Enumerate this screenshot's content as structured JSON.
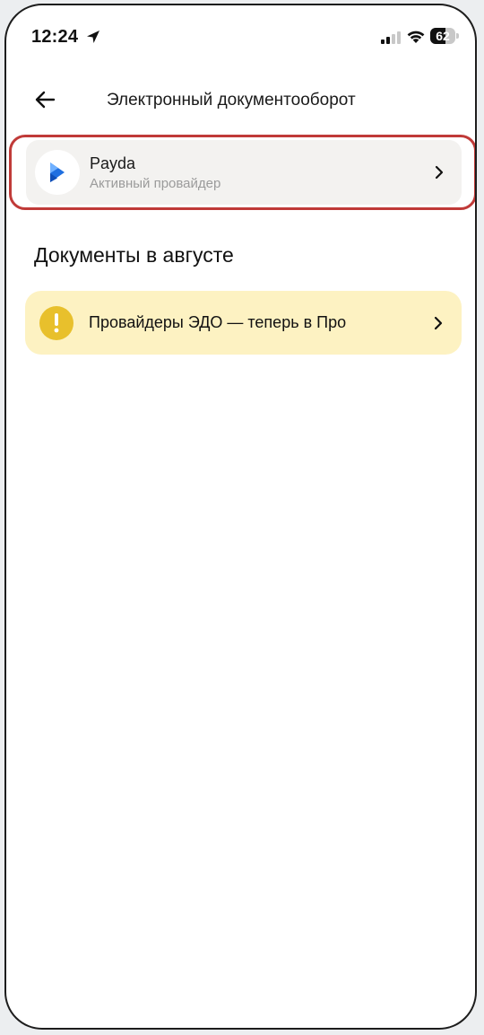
{
  "status_bar": {
    "time": "12:24",
    "battery_percent": "62",
    "battery_level": 0.62,
    "icons": [
      "location-arrow-icon",
      "cellular-signal-icon",
      "wifi-icon",
      "battery-icon"
    ]
  },
  "header": {
    "back_icon": "arrow-left-icon",
    "title": "Электронный документооборот"
  },
  "provider": {
    "name": "Payda",
    "status": "Активный провайдер",
    "highlighted": true,
    "highlight_color": "#c03a38",
    "logo_color": "#1f6fe0"
  },
  "documents": {
    "section_title": "Документы в августе"
  },
  "notice": {
    "text": "Провайдеры ЭДО — теперь в Про",
    "icon": "exclamation-icon",
    "background_color": "#fdf2c2",
    "icon_color": "#e8c02c"
  }
}
